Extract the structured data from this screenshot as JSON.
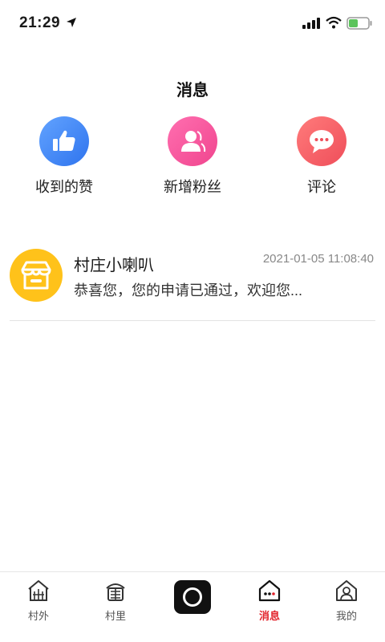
{
  "status_bar": {
    "time": "21:29"
  },
  "header": {
    "title": "消息"
  },
  "actions": [
    {
      "label": "收到的赞",
      "icon": "thumbs-up-icon",
      "color": "#3d82f2"
    },
    {
      "label": "新增粉丝",
      "icon": "new-fans-icon",
      "color": "#f5539a"
    },
    {
      "label": "评论",
      "icon": "comment-icon",
      "color": "#f35d66"
    }
  ],
  "messages": [
    {
      "name": "村庄小喇叭",
      "time": "2021-01-05 11:08:40",
      "preview": "恭喜您，您的申请已通过，欢迎您...",
      "avatar_icon": "shop-awning-icon",
      "avatar_color": "#ffc21a"
    }
  ],
  "bottom_nav": {
    "items": [
      {
        "label": "村外",
        "icon": "village-outside-icon"
      },
      {
        "label": "村里",
        "icon": "village-inside-icon"
      },
      {
        "label": "",
        "icon": "camera-icon"
      },
      {
        "label": "消息",
        "icon": "message-house-icon",
        "active": true
      },
      {
        "label": "我的",
        "icon": "profile-house-icon"
      }
    ],
    "active_color": "#e2232b"
  }
}
